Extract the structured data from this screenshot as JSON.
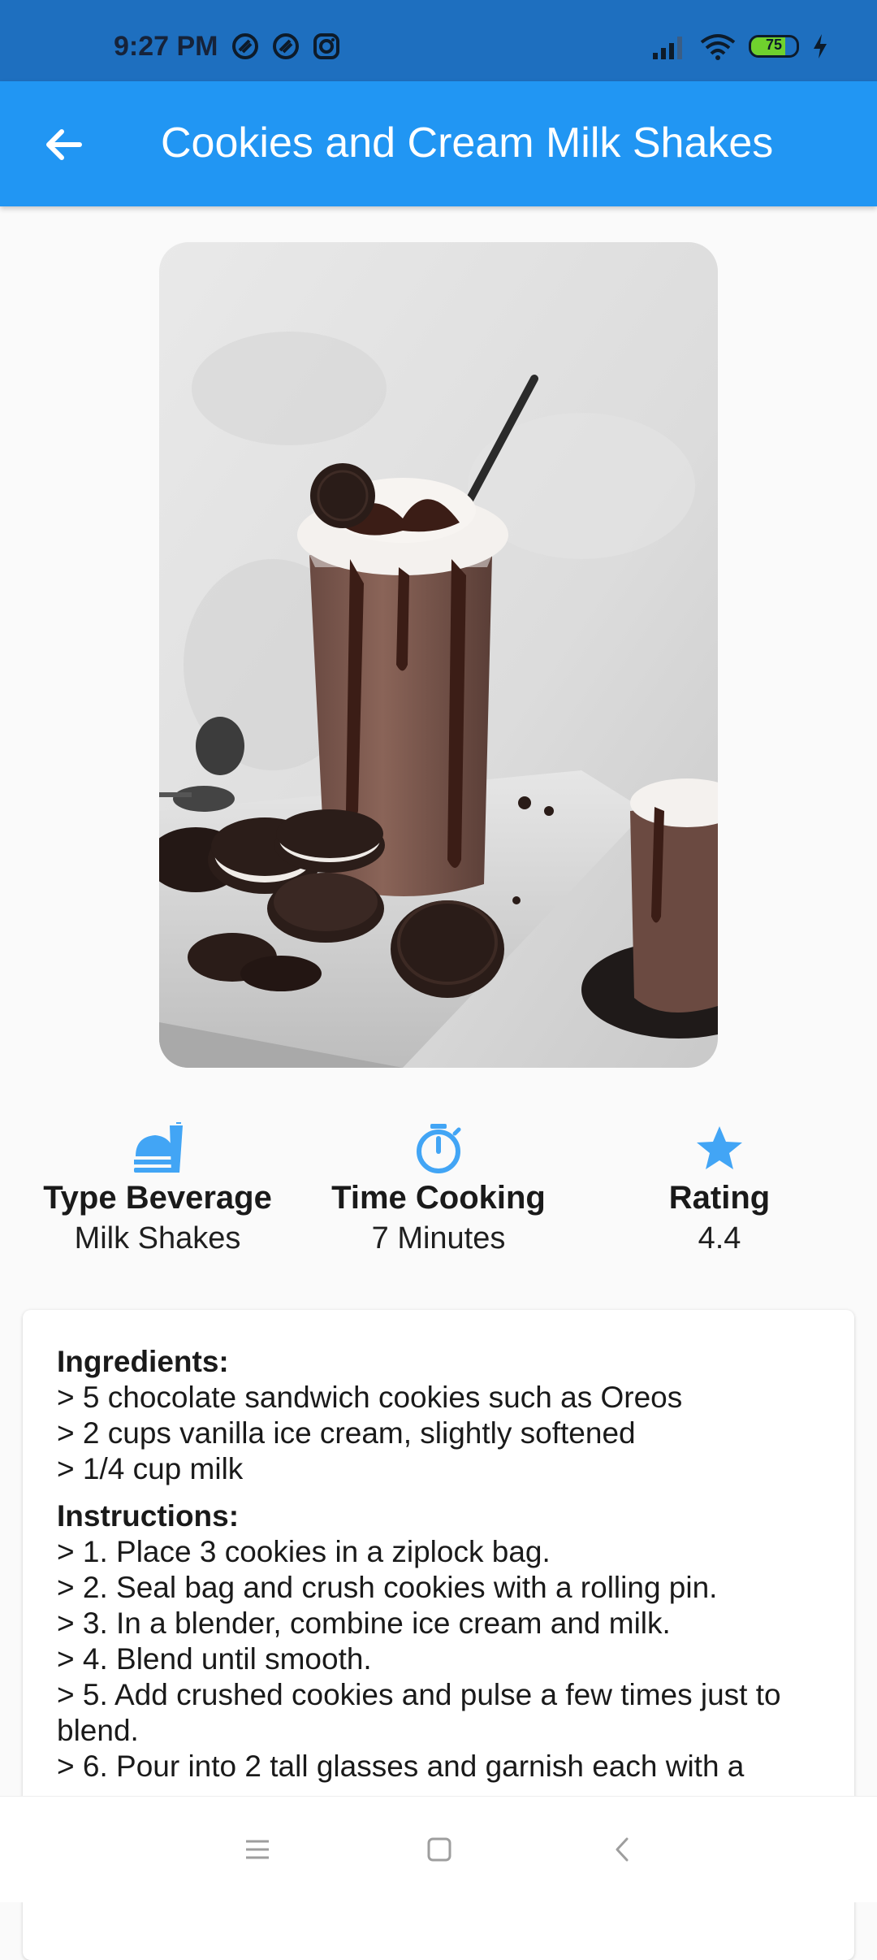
{
  "status_bar": {
    "time": "9:27 PM",
    "left_icons": [
      "notification-icon",
      "notification-icon",
      "instagram-icon"
    ],
    "battery_level": "75",
    "battery_fraction": 0.75,
    "right_icons": [
      "signal-icon",
      "wifi-icon",
      "battery-icon",
      "charging-icon"
    ]
  },
  "app_bar": {
    "title": "Cookies and Cream Milk Shakes",
    "back_icon": "arrow-left-icon",
    "color": "#2196f3"
  },
  "hero_image": {
    "subject": "cookies-and-cream-milkshake-photo"
  },
  "stats": [
    {
      "icon": "fastfood-icon",
      "title": "Type Beverage",
      "value": "Milk Shakes"
    },
    {
      "icon": "timer-icon",
      "title": "Time Cooking",
      "value": "7 Minutes"
    },
    {
      "icon": "star-icon",
      "title": "Rating",
      "value": "4.4"
    }
  ],
  "recipe": {
    "ingredients_heading": "Ingredients:",
    "ingredients": [
      "> 5 chocolate sandwich cookies such as Oreos",
      "> 2 cups vanilla ice cream, slightly softened",
      "> 1/4 cup milk"
    ],
    "instructions_heading": "Instructions:",
    "instructions": [
      "> 1. Place 3 cookies in a ziplock bag.",
      "> 2. Seal bag and crush cookies with a rolling pin.",
      "> 3. In a blender, combine ice cream and milk.",
      "> 4. Blend until smooth.",
      "> 5. Add crushed cookies and pulse a few times just to blend.",
      "> 6. Pour into 2 tall glasses and garnish each with a"
    ]
  },
  "nav_bar": {
    "icons": [
      "menu-icon",
      "home-square-icon",
      "back-chevron-icon"
    ]
  },
  "colors": {
    "accent": "#2196f3",
    "status_bar": "#1e6fbf",
    "icon_blue": "#42a5f5"
  }
}
